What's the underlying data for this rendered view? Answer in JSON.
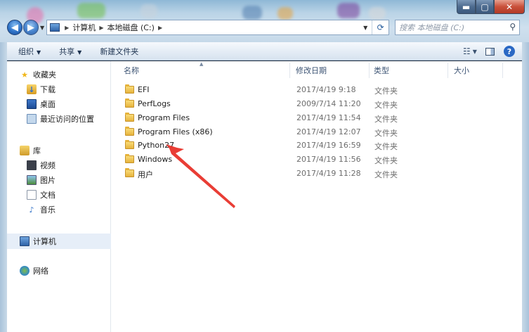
{
  "window": {
    "controls": {
      "minimize": "▬",
      "maximize": "▢",
      "close": "✕"
    }
  },
  "nav": {
    "back_glyph": "◀",
    "forward_glyph": "▶",
    "dropdown_glyph": "▼",
    "breadcrumb": [
      "计算机",
      "本地磁盘 (C:)"
    ],
    "refresh_glyph": "⟳",
    "search_placeholder": "搜索 本地磁盘 (C:)"
  },
  "toolbar": {
    "organize_label": "组织",
    "share_label": "共享",
    "new_folder_label": "新建文件夹",
    "caret": "▼"
  },
  "nav_pane": {
    "favorites": {
      "label": "收藏夹",
      "items": [
        "下载",
        "桌面",
        "最近访问的位置"
      ]
    },
    "libraries": {
      "label": "库",
      "items": [
        "视频",
        "图片",
        "文档",
        "音乐"
      ]
    },
    "computer": "计算机",
    "network": "网络"
  },
  "file_list": {
    "columns": {
      "name": "名称",
      "date": "修改日期",
      "type": "类型",
      "size": "大小"
    },
    "rows": [
      {
        "name": "EFI",
        "date": "2017/4/19 9:18",
        "type": "文件夹"
      },
      {
        "name": "PerfLogs",
        "date": "2009/7/14 11:20",
        "type": "文件夹"
      },
      {
        "name": "Program Files",
        "date": "2017/4/19 11:54",
        "type": "文件夹"
      },
      {
        "name": "Program Files (x86)",
        "date": "2017/4/19 12:07",
        "type": "文件夹"
      },
      {
        "name": "Python27",
        "date": "2017/4/19 16:59",
        "type": "文件夹"
      },
      {
        "name": "Windows",
        "date": "2017/4/19 11:56",
        "type": "文件夹"
      },
      {
        "name": "用户",
        "date": "2017/4/19 11:28",
        "type": "文件夹"
      }
    ]
  },
  "colors": {
    "annotation_arrow": "#e8332a",
    "accent": "#2f73c8"
  }
}
